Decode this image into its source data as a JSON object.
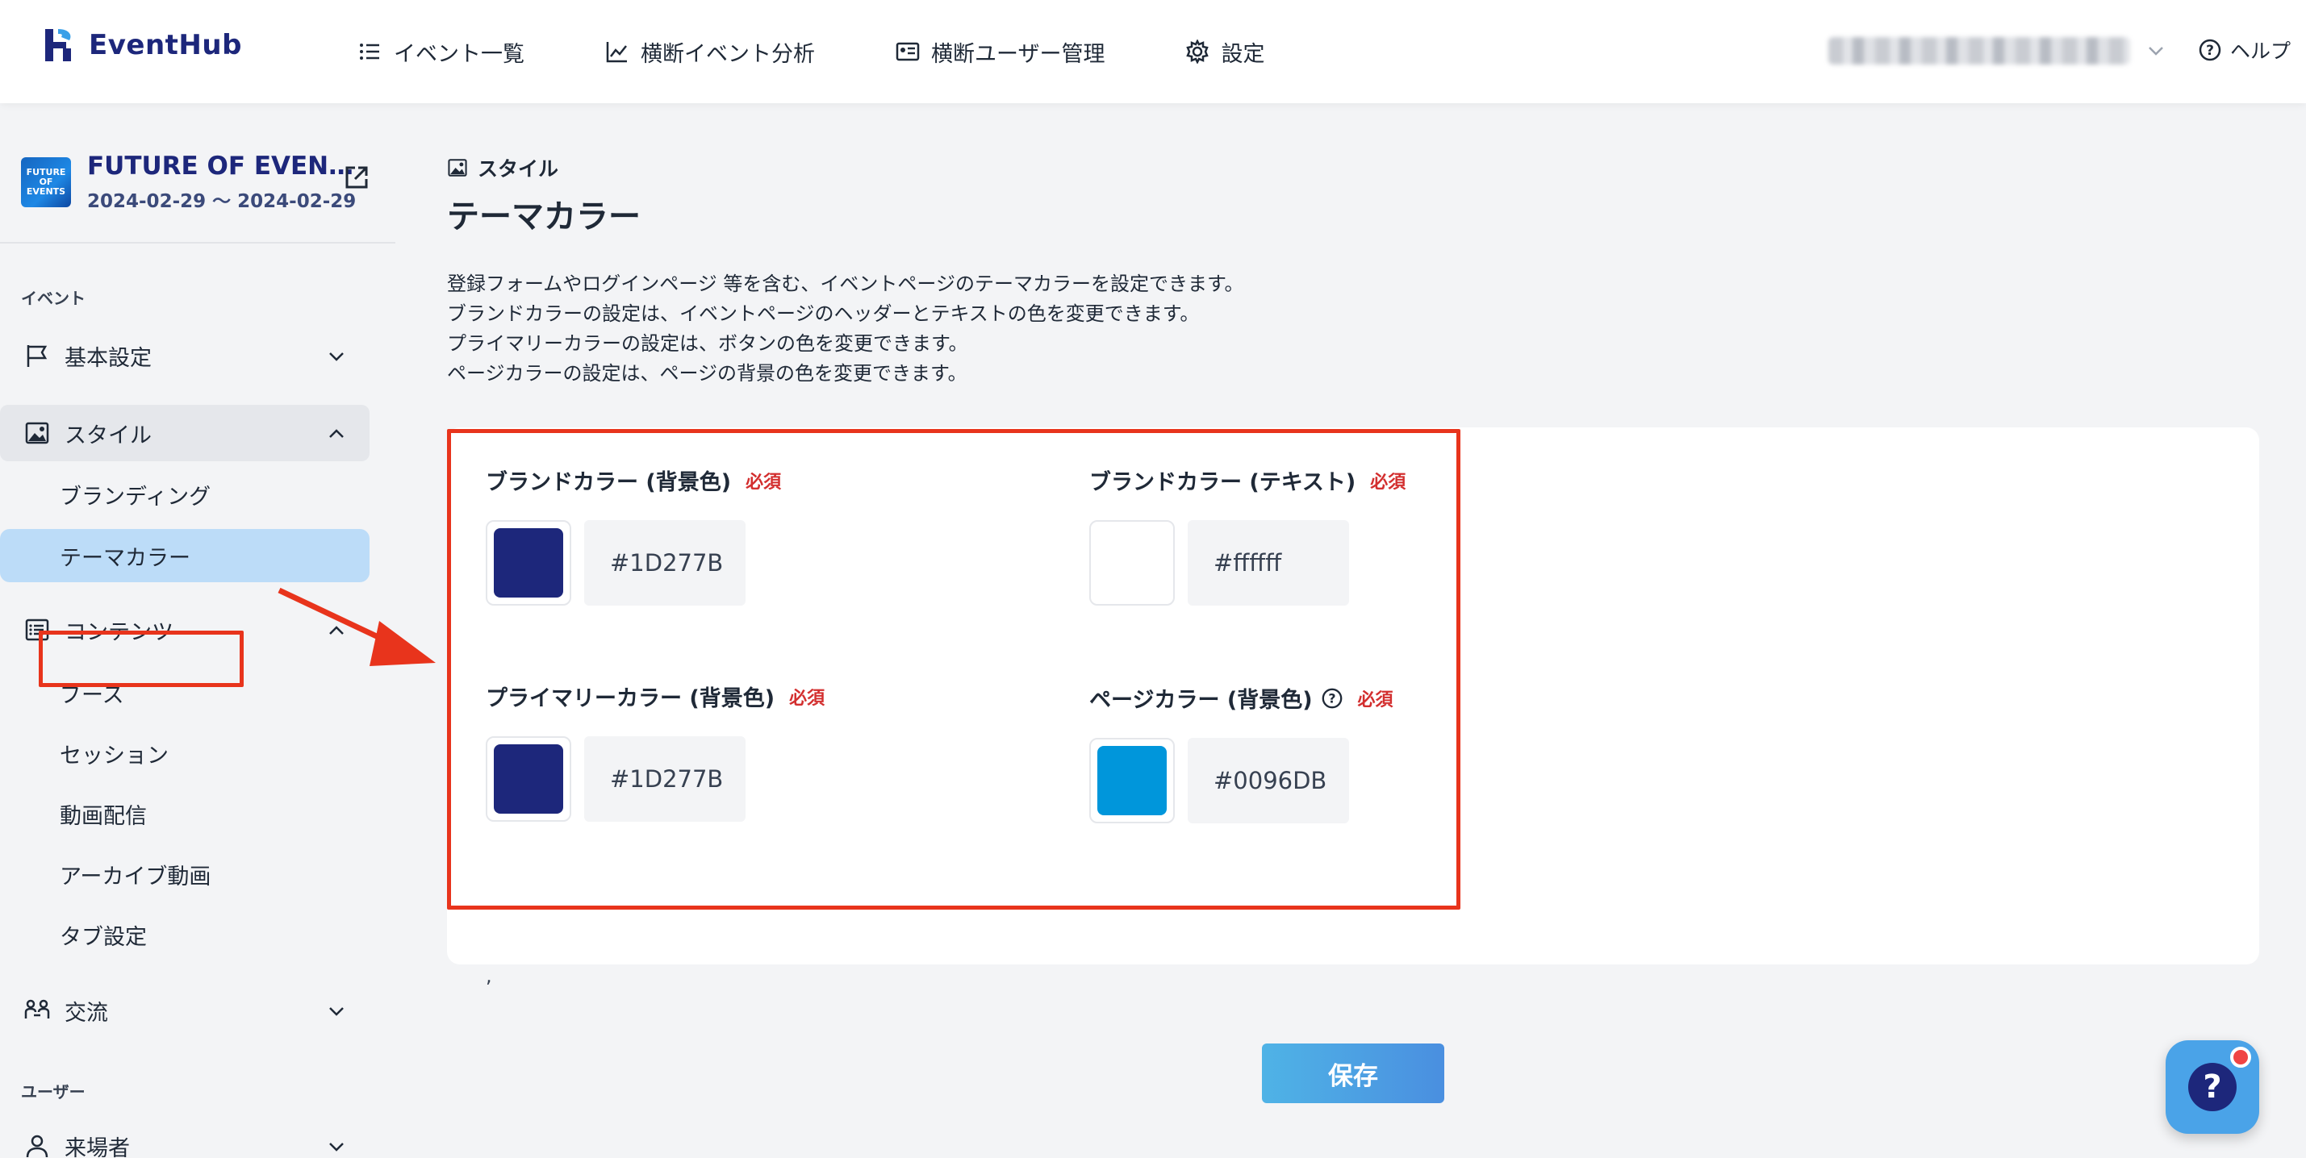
{
  "app": {
    "name": "EventHub",
    "brand_color": "#1D277B"
  },
  "header": {
    "nav": [
      {
        "label": "イベント一覧",
        "icon": "list-icon"
      },
      {
        "label": "横断イベント分析",
        "icon": "chart-line-icon"
      },
      {
        "label": "横断ユーザー管理",
        "icon": "id-card-icon"
      },
      {
        "label": "設定",
        "icon": "gear-icon"
      }
    ],
    "help_label": "ヘルプ"
  },
  "sidebar": {
    "event": {
      "title": "FUTURE OF EVEN…",
      "dates": "2024-02-29 〜 2024-02-29",
      "thumb_text": "FUTURE OF EVENTS"
    },
    "sections": {
      "event_label": "イベント",
      "user_label": "ユーザー"
    },
    "items": {
      "basic": "基本設定",
      "style": "スタイル",
      "branding": "ブランディング",
      "theme_color": "テーマカラー",
      "contents": "コンテンツ",
      "booth": "ブース",
      "session": "セッション",
      "video": "動画配信",
      "archive": "アーカイブ動画",
      "tabs": "タブ設定",
      "exchange": "交流",
      "visitors": "来場者"
    }
  },
  "main": {
    "breadcrumb": "スタイル",
    "title": "テーマカラー",
    "description": [
      "登録フォームやログインページ 等を含む、イベントページのテーマカラーを設定できます。",
      "ブランドカラーの設定は、イベントページのヘッダーとテキストの色を変更できます。",
      "プライマリーカラーの設定は、ボタンの色を変更できます。",
      "ページカラーの設定は、ページの背景の色を変更できます。"
    ],
    "fields": {
      "brand_bg": {
        "label": "ブランドカラー (背景色)",
        "required": "必須",
        "value": "#1D277B",
        "color": "#1D277B"
      },
      "brand_text": {
        "label": "ブランドカラー (テキスト)",
        "required": "必須",
        "value": "#ffffff",
        "color": "#ffffff"
      },
      "primary_bg": {
        "label": "プライマリーカラー (背景色)",
        "required": "必須",
        "value": "#1D277B",
        "color": "#1D277B"
      },
      "page_bg": {
        "label": "ページカラー (背景色)",
        "required": "必須",
        "value": "#0096DB",
        "color": "#0096DB"
      }
    },
    "stray_text": ",",
    "save_label": "保存"
  },
  "colors": {
    "highlight": "#e8341c",
    "selected_bg": "#bcdcf8",
    "required": "#d32f2f"
  }
}
